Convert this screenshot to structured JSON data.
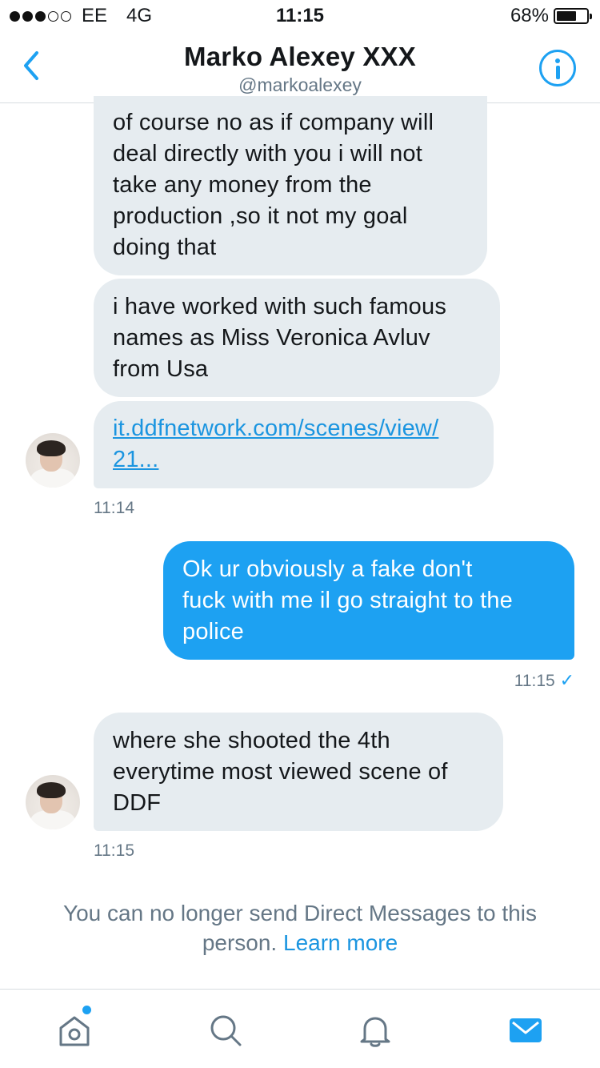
{
  "status_bar": {
    "signal_dots": [
      true,
      true,
      true,
      false,
      false
    ],
    "carrier": "EE",
    "network": "4G",
    "time": "11:15",
    "battery_percent_label": "68%",
    "battery_level": 0.68
  },
  "header": {
    "back_icon": "chevron-left-icon",
    "title": "Marko Alexey XXX",
    "handle": "@markoalexey",
    "info_icon": "info-circle-icon"
  },
  "messages": [
    {
      "direction": "incoming",
      "lines": [
        "of course no as if company will",
        "deal directly with you i will not",
        "take any money from the",
        "production ,so it not my goal",
        "doing that"
      ]
    },
    {
      "direction": "incoming",
      "lines": [
        "i have worked with such famous",
        "names as Miss Veronica Avluv",
        "from Usa"
      ]
    },
    {
      "direction": "incoming",
      "link_lines": [
        "it.ddfnetwork.com/scenes/view/",
        "21..."
      ]
    },
    {
      "timestamp": "11:14"
    },
    {
      "direction": "outgoing",
      "lines": [
        "Ok ur obviously a fake don't",
        "fuck with me il go straight to the",
        "police"
      ]
    },
    {
      "timestamp": "11:15",
      "read_check": "✓"
    },
    {
      "direction": "incoming",
      "lines": [
        "where she shooted the 4th",
        "everytime most viewed scene of",
        "DDF"
      ]
    },
    {
      "timestamp": "11:15"
    }
  ],
  "notice": {
    "line1": "You can no longer send Direct Messages to this",
    "line2": "person.",
    "link": "Learn more"
  },
  "tabbar": {
    "items": [
      {
        "icon": "home-icon",
        "has_badge": true
      },
      {
        "icon": "search-icon"
      },
      {
        "icon": "notifications-bell-icon"
      },
      {
        "icon": "messages-envelope-icon",
        "active": true
      }
    ]
  },
  "colors": {
    "accent": "#1da1f2",
    "link": "#1b95e0",
    "incoming_bubble": "#e6ecf0",
    "muted_text": "#657786"
  }
}
